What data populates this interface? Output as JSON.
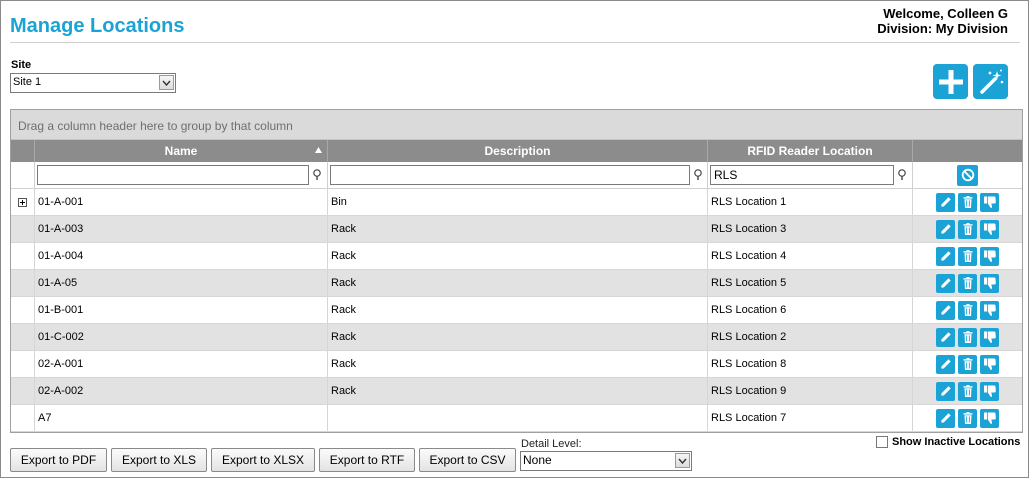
{
  "header": {
    "title": "Manage Locations",
    "welcome": "Welcome, Colleen G",
    "division": "Division: My Division"
  },
  "site": {
    "label": "Site",
    "selected": "Site 1"
  },
  "toolbar": {
    "add_icon": "plus-icon",
    "wizard_icon": "magic-wand-icon"
  },
  "grid": {
    "group_hint": "Drag a column header here to group by that column",
    "columns": {
      "name": "Name",
      "description": "Description",
      "rfid": "RFID Reader Location"
    },
    "filters": {
      "name": "",
      "description": "",
      "rfid": "RLS"
    },
    "rows": [
      {
        "name": "01-A-001",
        "description": "Bin",
        "rfid": "RLS Location 1"
      },
      {
        "name": "01-A-003",
        "description": "Rack",
        "rfid": "RLS Location 3"
      },
      {
        "name": "01-A-004",
        "description": "Rack",
        "rfid": "RLS Location 4"
      },
      {
        "name": "01-A-05",
        "description": "Rack",
        "rfid": "RLS Location 5"
      },
      {
        "name": "01-B-001",
        "description": "Rack",
        "rfid": "RLS Location 6"
      },
      {
        "name": "01-C-002",
        "description": "Rack",
        "rfid": "RLS Location 2"
      },
      {
        "name": "02-A-001",
        "description": "Rack",
        "rfid": "RLS Location 8"
      },
      {
        "name": "02-A-002",
        "description": "Rack",
        "rfid": "RLS Location 9"
      },
      {
        "name": "A7",
        "description": "",
        "rfid": "RLS Location 7"
      }
    ]
  },
  "footer": {
    "export_pdf": "Export to PDF",
    "export_xls": "Export to XLS",
    "export_xlsx": "Export to XLSX",
    "export_rtf": "Export to RTF",
    "export_csv": "Export to CSV",
    "detail_label": "Detail Level:",
    "detail_selected": "None",
    "show_inactive": "Show Inactive Locations"
  },
  "colors": {
    "accent": "#1ba3d6",
    "header_bg": "#8c8c8c",
    "alt_row": "#e2e2e2"
  }
}
